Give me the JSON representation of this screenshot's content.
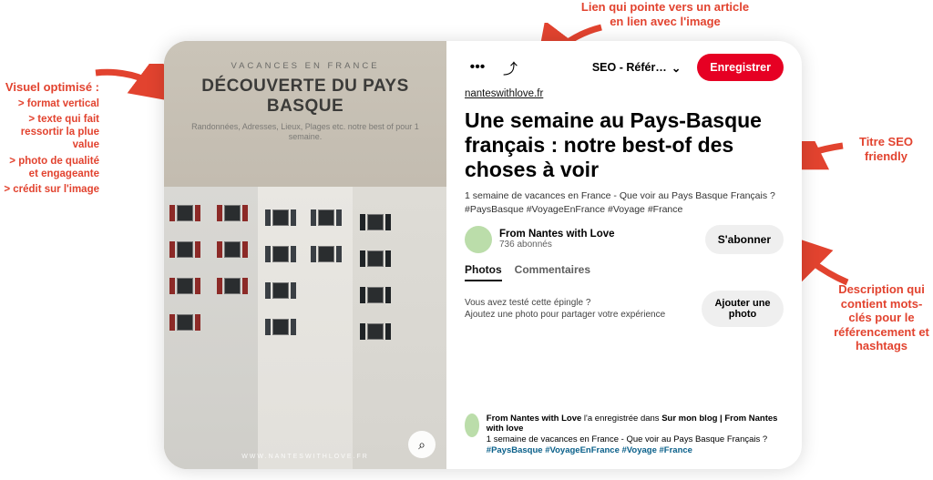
{
  "annotations": {
    "top": {
      "title": "Lien qui pointe vers un article en lien avec l'image"
    },
    "left": {
      "title": "Visuel optimisé :",
      "points": [
        "> format vertical",
        "> texte qui fait ressortir la plue value",
        "> photo de qualité et engageante",
        "> crédit sur l'image"
      ]
    },
    "r1": {
      "title": "Titre SEO friendly"
    },
    "r2": {
      "title": "Description qui contient mots-clés pour le référencement et hashtags"
    }
  },
  "pin_image": {
    "category": "VACANCES EN FRANCE",
    "headline": "DÉCOUVERTE DU PAYS BASQUE",
    "subline": "Randonnées, Adresses, Lieux, Plages etc. notre best of pour 1 semaine.",
    "credit": "WWW.NANTESWITHLOVE.FR",
    "lens_icon": "⌕"
  },
  "toolbar": {
    "more_glyph": "•••",
    "share_glyph": "⤴",
    "board_label": "SEO - Référ…",
    "chevron": "⌄",
    "save_label": "Enregistrer"
  },
  "source_link": "nanteswithlove.fr",
  "title": "Une semaine au Pays-Basque français : notre best-of des choses à voir",
  "description": "1 semaine de vacances en France - Que voir au Pays Basque Français ? #PaysBasque #VoyageEnFrance #Voyage #France",
  "author": {
    "name": "From Nantes with Love",
    "followers": "736 abonnés",
    "follow_label": "S'abonner"
  },
  "tabs": {
    "photos": "Photos",
    "comments": "Commentaires"
  },
  "tried": {
    "q": "Vous avez testé cette épingle ?",
    "hint": "Ajoutez une photo pour partager votre expérience",
    "button": "Ajouter une photo"
  },
  "saved": {
    "actor": "From Nantes with Love",
    "verb": " l'a enregistrée dans ",
    "board": "Sur mon blog | From Nantes with love",
    "desc_plain": "1 semaine de vacances en France - Que voir au Pays Basque Français ? ",
    "desc_tags": "#PaysBasque #VoyageEnFrance #Voyage #France"
  }
}
